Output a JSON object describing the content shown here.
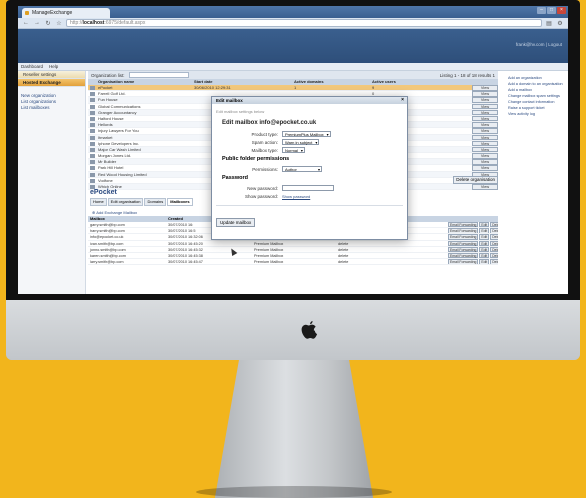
{
  "browser": {
    "tab_title": "ManageExchange",
    "url_prefix": "http://",
    "url_host": "localhost",
    "url_path": ":6975/default.aspx"
  },
  "header": {
    "user_link": "frank@hv.com | Logout"
  },
  "menubar": {
    "items": [
      "Dashboard",
      "Help"
    ]
  },
  "left_nav": {
    "groups": [
      "Reseller settings",
      "Hosted Exchange"
    ],
    "active_index": 1,
    "links": [
      "New organization",
      "List organizations",
      "List mailboxes"
    ]
  },
  "org_list": {
    "filter_label": "Organization list:",
    "listing": "Listing 1 - 18 of 18 results  1",
    "columns": [
      "Organisation name",
      "Start date",
      "Active domains",
      "Active users",
      ""
    ],
    "rows": [
      {
        "name": "ePocket",
        "date": "30/06/2010 12:29:31",
        "domains": "1",
        "users": "9"
      },
      {
        "name": "Farrell Golf Ltd.",
        "date": "",
        "domains": "",
        "users": "0"
      },
      {
        "name": "Fun House",
        "date": "",
        "domains": "",
        "users": "0"
      },
      {
        "name": "Global Communications",
        "date": "",
        "domains": "",
        "users": "0"
      },
      {
        "name": "Granger Accountancy",
        "date": "",
        "domains": "",
        "users": "0"
      },
      {
        "name": "Halford House",
        "date": "",
        "domains": "",
        "users": "0"
      },
      {
        "name": "Hellords",
        "date": "",
        "domains": "",
        "users": "0"
      },
      {
        "name": "Injury Lawyers For You",
        "date": "",
        "domains": "",
        "users": "0"
      },
      {
        "name": "Itmarket",
        "date": "",
        "domains": "",
        "users": "0"
      },
      {
        "name": "Iphone Developers Inc.",
        "date": "",
        "domains": "",
        "users": "0"
      },
      {
        "name": "Major Car Wash Limited",
        "date": "",
        "domains": "",
        "users": "0"
      },
      {
        "name": "Morgan Jones Ltd.",
        "date": "",
        "domains": "",
        "users": "0"
      },
      {
        "name": "Mr Builder",
        "date": "",
        "domains": "",
        "users": "0"
      },
      {
        "name": "Park Hill Hotel",
        "date": "",
        "domains": "",
        "users": "0"
      },
      {
        "name": "Red Wood Housing Limited",
        "date": "",
        "domains": "",
        "users": "0"
      },
      {
        "name": "Vodfone",
        "date": "",
        "domains": "",
        "users": "0"
      },
      {
        "name": "Which Online",
        "date": "",
        "domains": "",
        "users": "0"
      }
    ],
    "view_label": "View"
  },
  "org_panel": {
    "title": "ePocket",
    "delete_label": "Delete organisation",
    "tabs": [
      "Home",
      "Edit organisation",
      "Domains",
      "Mailboxes"
    ],
    "active_tab": 3,
    "add_link": "Add Exchange Mailbox",
    "columns": [
      "Mailbox",
      "Created",
      "",
      "",
      ""
    ],
    "rows": [
      {
        "email": "garry.smith@bp.com",
        "created": "30/07/2010 16:",
        "type": "",
        "spam": ""
      },
      {
        "email": "harry.smith@bp.com",
        "created": "30/07/2010 16:5",
        "type": "Premium Mailbox",
        "spam": "delete"
      },
      {
        "email": "info@epocket.co.uk",
        "created": "30/07/2010 16:32:06",
        "type": "Premium Plus Mailbox",
        "spam": "warn"
      },
      {
        "email": "ivan.smith@bp.com",
        "created": "30/07/2010 16:45:20",
        "type": "Premium Mailbox",
        "spam": "delete"
      },
      {
        "email": "jonno.smith@bp.com",
        "created": "30/07/2010 16:45:32",
        "type": "Premium Mailbox",
        "spam": "delete"
      },
      {
        "email": "karen.smith@bp.com",
        "created": "30/07/2010 16:45:38",
        "type": "Premium Mailbox",
        "spam": "delete"
      },
      {
        "email": "larry.smith@bp.com",
        "created": "30/07/2010 16:45:47",
        "type": "Premium Mailbox",
        "spam": "delete"
      }
    ],
    "actions": [
      "Email Forwarding",
      "Edit",
      "Delete"
    ]
  },
  "right_nav": {
    "links": [
      "Add an organization",
      "Add a domain to an organisation",
      "Add a mailbox",
      "Change mailbox spam settings",
      "Change contact information",
      "Raise a support ticket",
      "View activity log"
    ]
  },
  "modal": {
    "title": "Edit mailbox",
    "subtitle": "Edit mailbox settings below",
    "heading": "Edit mailbox info@epocket.co.uk",
    "product_type_label": "Product type:",
    "product_type_value": "PremiumPlus Mailbox",
    "spam_action_label": "Spam action:",
    "spam_action_value": "Warn in subject",
    "mailbox_type_label": "Mailbox type:",
    "mailbox_type_value": "Normal",
    "pf_title": "Public folder permissions",
    "permissions_label": "Permissions:",
    "permissions_value": "Author",
    "password_title": "Password",
    "new_password_label": "New password:",
    "show_password_label": "Show password:",
    "show_password_link": "Show password",
    "update_button": "Update mailbox"
  },
  "colors": {
    "backdrop": "#f2b51c",
    "header": "#2e4f7a",
    "selected_row": "#f2c87c",
    "link": "#2b4a80"
  },
  "icons": [
    "apple-logo-icon",
    "back-icon",
    "forward-icon",
    "refresh-icon",
    "star-icon",
    "close-icon"
  ]
}
